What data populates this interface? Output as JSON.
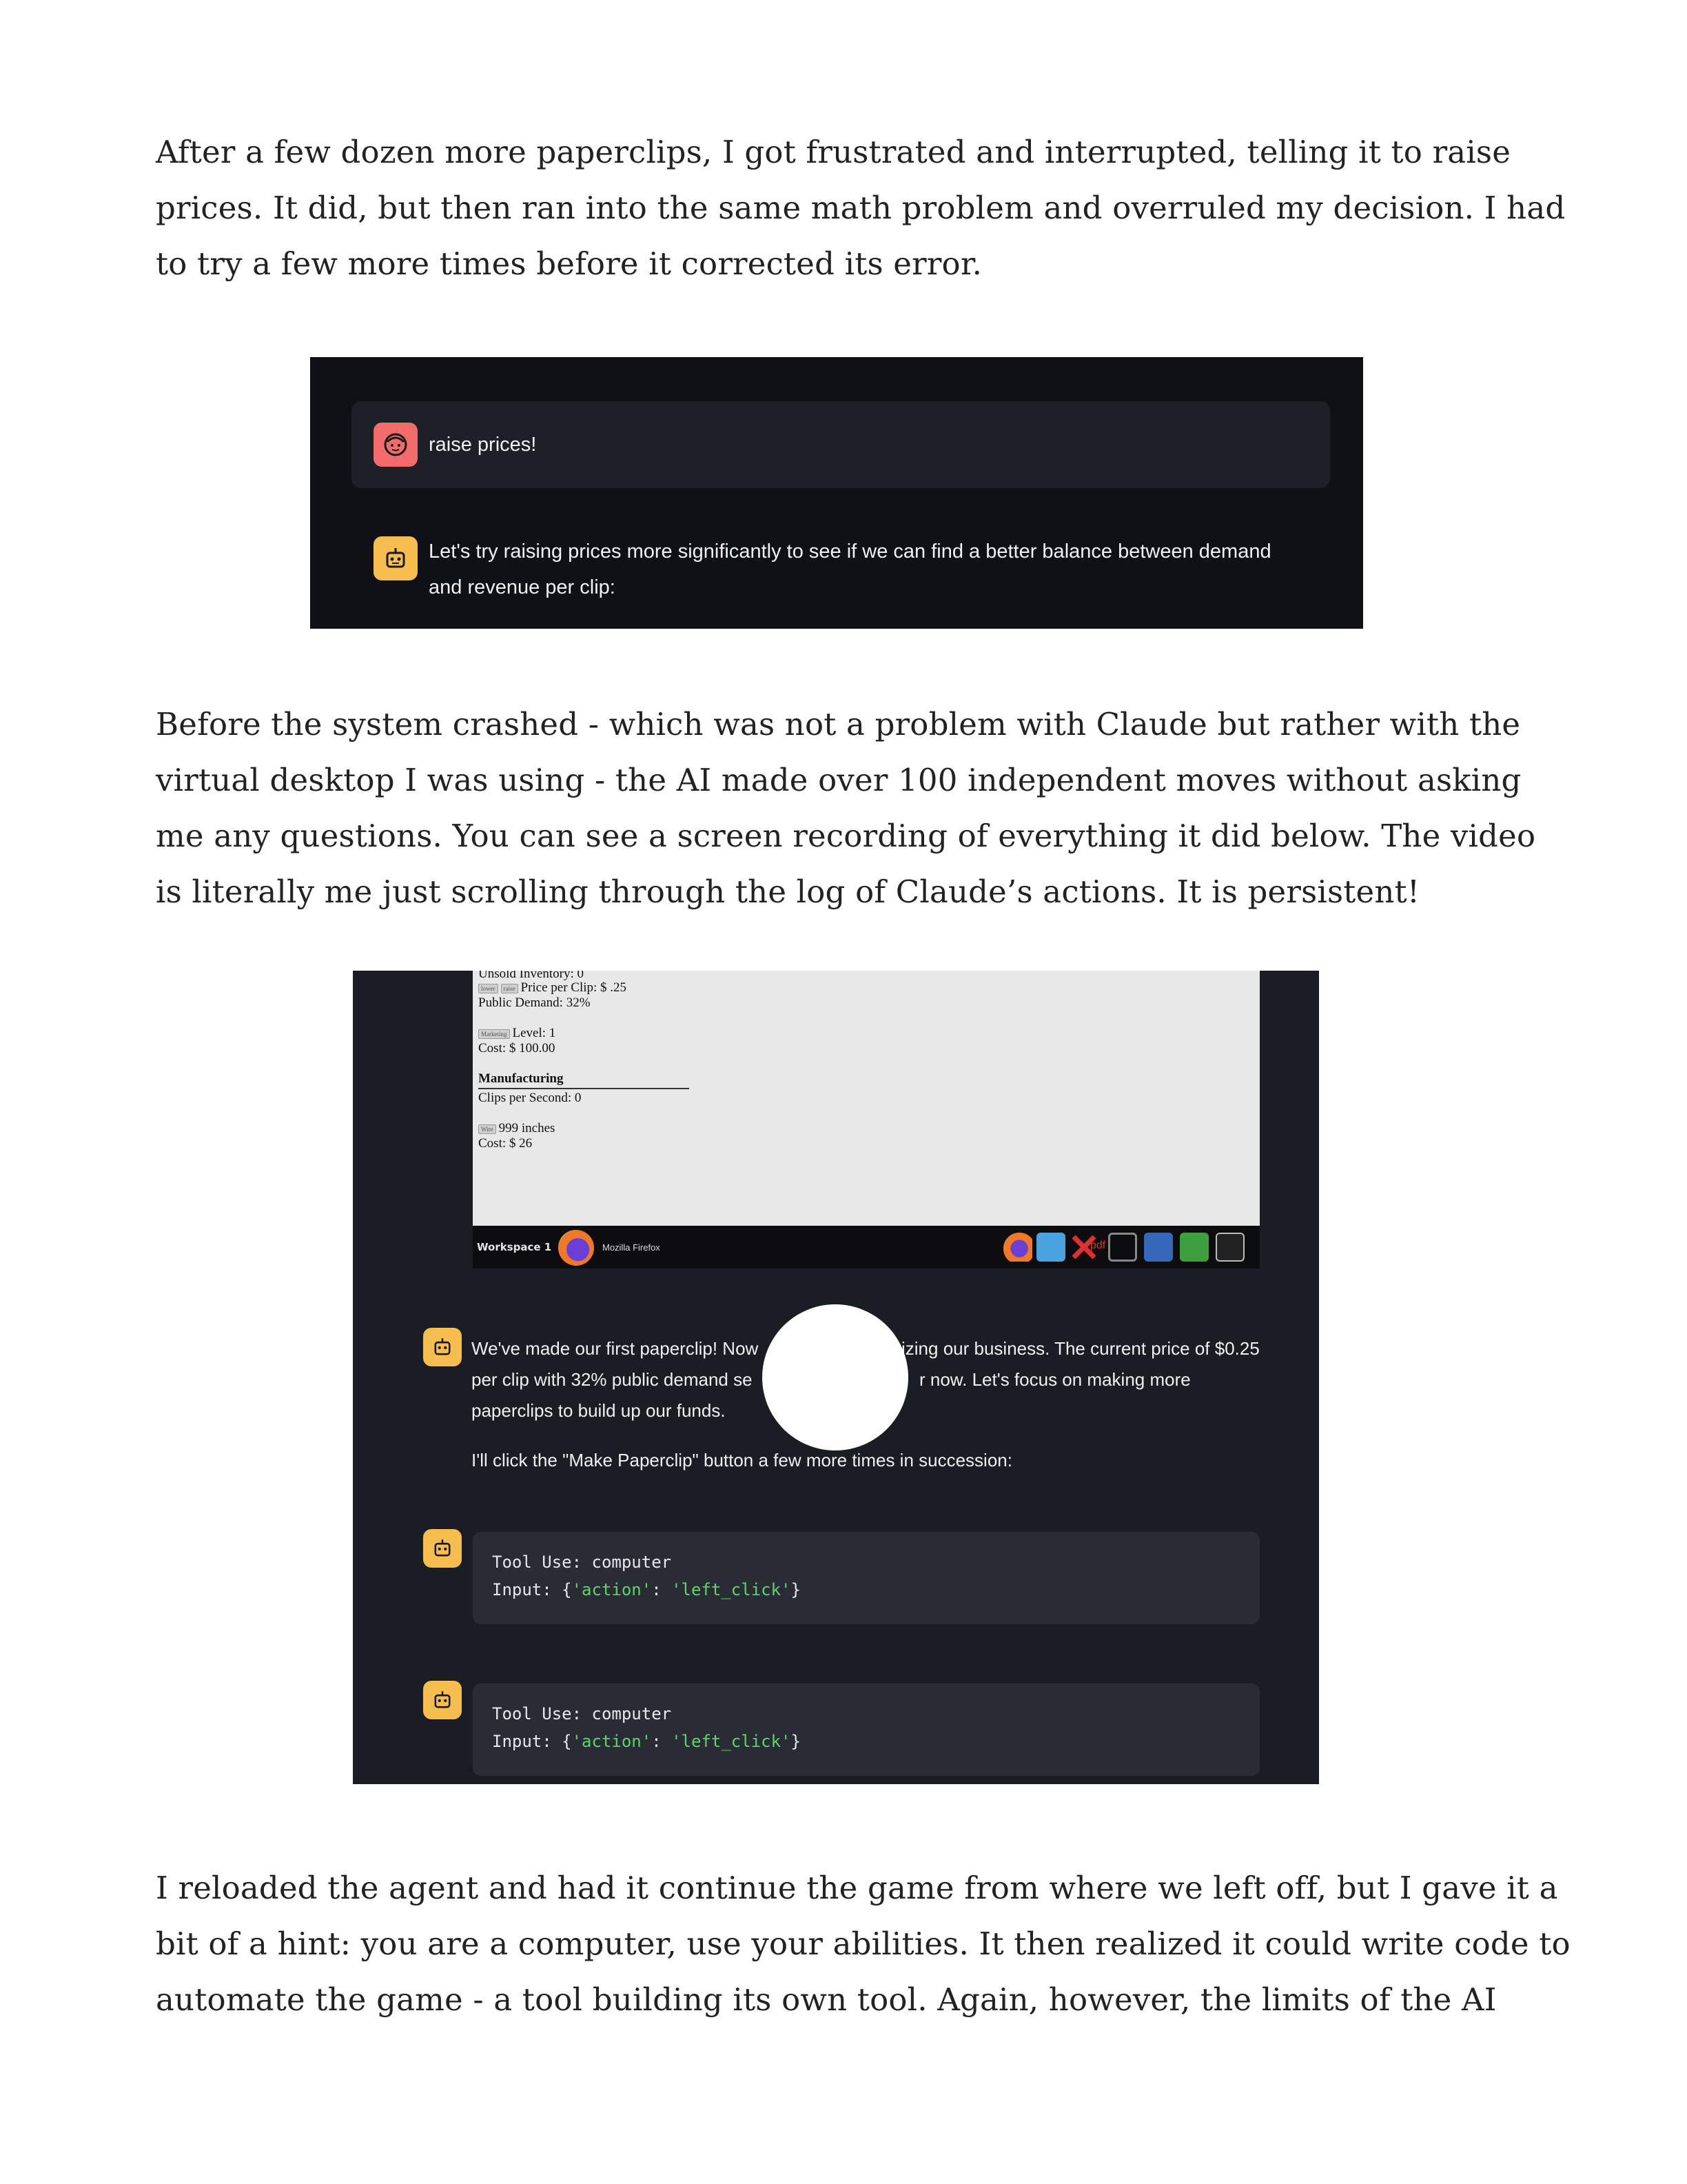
{
  "paragraphs": {
    "p1": [
      "After a few dozen more paperclips, I got frustrated and interrupted, telling it to raise",
      "prices. It did, but then ran into the same math problem and overruled my decision. I had",
      "to try a few more times before it corrected its error."
    ],
    "p2": [
      "Before the system crashed - which was not a problem with Claude but rather with the",
      "virtual desktop I was using - the AI made over 100 independent moves without asking",
      "me any questions. You can see a screen recording of everything it did below. The video",
      "is literally me just scrolling through the log of Claude’s actions. It is persistent!"
    ],
    "p3": [
      "I reloaded the agent and had it continue the game from where we left off, but I gave it a",
      "bit of a hint: you are a computer, use your abilities. It then realized it could write code to",
      "automate the game - a tool building its own tool. Again, however, the limits of the AI"
    ]
  },
  "screenshot1": {
    "user_message": "raise prices!",
    "bot_message_lines": [
      "Let's try raising prices more significantly to see if we can find a better balance between demand",
      "and revenue per clip:"
    ],
    "colors": {
      "background": "#0f1116",
      "user_avatar": "#f36b6b",
      "bot_avatar": "#f7be4f"
    }
  },
  "screenshot2": {
    "game": {
      "unsold_inventory": "Unsold Inventory: 0",
      "lower_button": "lower",
      "raise_button": "raise",
      "price_per_clip": "Price per Clip: $ .25",
      "public_demand": "Public Demand: 32%",
      "marketing_button": "Marketing",
      "marketing_level": "Level: 1",
      "marketing_cost": "Cost: $ 100.00",
      "manufacturing_heading": "Manufacturing",
      "clips_per_second": "Clips per Second: 0",
      "wire_button": "Wire",
      "wire_amount": "999 inches",
      "wire_cost": "Cost: $ 26"
    },
    "taskbar": {
      "workspace": "Workspace 1",
      "app_label": "Mozilla Firefox",
      "tray_icons": [
        "firefox-icon",
        "image-viewer-icon",
        "pdf-icon",
        "editor-icon",
        "calculator-icon",
        "spreadsheet-icon",
        "terminal-icon"
      ],
      "pdf_label": "pdf"
    },
    "chat": {
      "line1_left": "We've made our first paperclip! Now",
      "line1_right": "izing our business. The current price of $0.25",
      "line2_left": "per clip with 32% public demand se",
      "line2_right": "r now. Let's focus on making more",
      "line3": "paperclips to build up our funds.",
      "line4": "I'll click the \"Make Paperclip\" button a few more times in succession:"
    },
    "tool_calls": [
      {
        "tool_label": "Tool Use:",
        "tool_name": "computer",
        "input_label": "Input:",
        "open": "{",
        "key": "'action'",
        "sep": ": ",
        "value": "'left_click'",
        "close": "}"
      },
      {
        "tool_label": "Tool Use:",
        "tool_name": "computer",
        "input_label": "Input:",
        "open": "{",
        "key": "'action'",
        "sep": ": ",
        "value": "'left_click'",
        "close": "}"
      }
    ],
    "colors": {
      "background": "#1b1d24",
      "code_string": "#5fd36a",
      "bot_avatar": "#f7be4f"
    }
  }
}
